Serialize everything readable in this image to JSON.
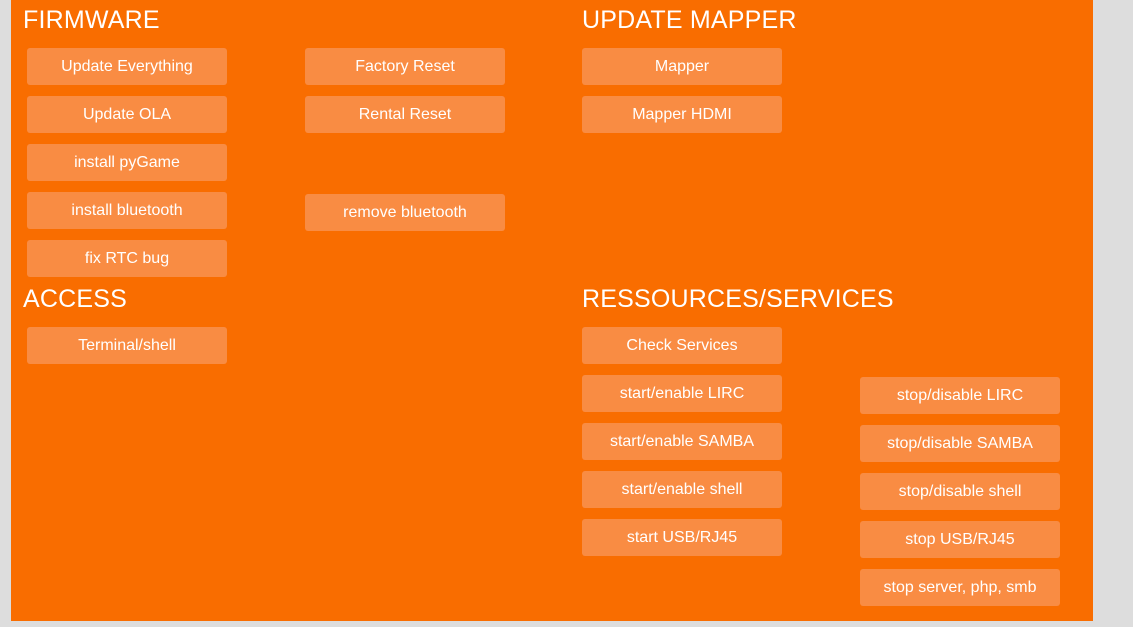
{
  "theme": {
    "background": "#f96d00",
    "button": "#f98c43",
    "text": "#ffffff",
    "gutter": "#dddddd"
  },
  "sections": {
    "firmware": {
      "title": "FIRMWARE",
      "column1": [
        {
          "label": "Update Everything"
        },
        {
          "label": "Update OLA"
        },
        {
          "label": "install pyGame"
        },
        {
          "label": "install bluetooth"
        },
        {
          "label": "fix RTC bug"
        }
      ],
      "column2": [
        {
          "label": "Factory Reset"
        },
        {
          "label": "Rental Reset"
        },
        {
          "label": "remove bluetooth"
        }
      ]
    },
    "update_mapper": {
      "title": "UPDATE MAPPER",
      "column1": [
        {
          "label": "Mapper"
        },
        {
          "label": "Mapper HDMI"
        }
      ]
    },
    "access": {
      "title": "ACCESS",
      "column1": [
        {
          "label": "Terminal/shell"
        }
      ]
    },
    "resources_services": {
      "title": "RESSOURCES/SERVICES",
      "column1": [
        {
          "label": "Check Services"
        },
        {
          "label": "start/enable LIRC"
        },
        {
          "label": "start/enable SAMBA"
        },
        {
          "label": "start/enable shell"
        },
        {
          "label": "start USB/RJ45"
        }
      ],
      "column2": [
        {
          "label": "stop/disable LIRC"
        },
        {
          "label": "stop/disable SAMBA"
        },
        {
          "label": "stop/disable shell"
        },
        {
          "label": "stop USB/RJ45"
        },
        {
          "label": "stop server, php, smb"
        }
      ]
    }
  }
}
